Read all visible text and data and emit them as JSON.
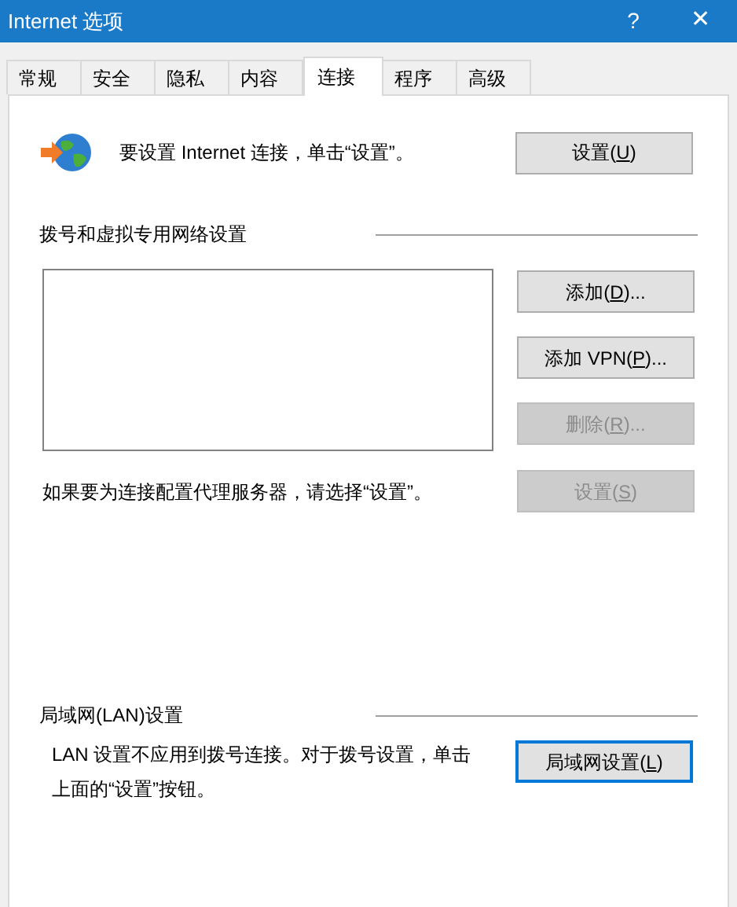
{
  "window": {
    "title": "Internet 选项",
    "help": "?",
    "close": "✕"
  },
  "tabs": [
    {
      "label": "常规",
      "selected": false
    },
    {
      "label": "安全",
      "selected": false
    },
    {
      "label": "隐私",
      "selected": false
    },
    {
      "label": "内容",
      "selected": false
    },
    {
      "label": "连接",
      "selected": true
    },
    {
      "label": "程序",
      "selected": false
    },
    {
      "label": "高级",
      "selected": false
    }
  ],
  "setup": {
    "text": "要设置 Internet 连接，单击“设置”。",
    "button": {
      "before": "设置(",
      "key": "U",
      "after": ")",
      "disabled": false,
      "focused": false
    }
  },
  "dialup": {
    "heading": "拨号和虚拟专用网络设置",
    "buttons": [
      {
        "before": "添加(",
        "key": "D",
        "after": ")...",
        "disabled": false,
        "focused": false
      },
      {
        "before": "添加 VPN(",
        "key": "P",
        "after": ")...",
        "disabled": false,
        "focused": false
      },
      {
        "before": "删除(",
        "key": "R",
        "after": ")...",
        "disabled": true,
        "focused": false
      }
    ],
    "proxy_text": "如果要为连接配置代理服务器，请选择“设置”。",
    "proxy_button": {
      "before": "设置(",
      "key": "S",
      "after": ")",
      "disabled": true,
      "focused": false
    }
  },
  "lan": {
    "heading": "局域网(LAN)设置",
    "text": "LAN 设置不应用到拨号连接。对于拨号设置，单击上面的“设置”按钮。",
    "button": {
      "before": "局域网设置(",
      "key": "L",
      "after": ")",
      "disabled": false,
      "focused": true
    }
  }
}
